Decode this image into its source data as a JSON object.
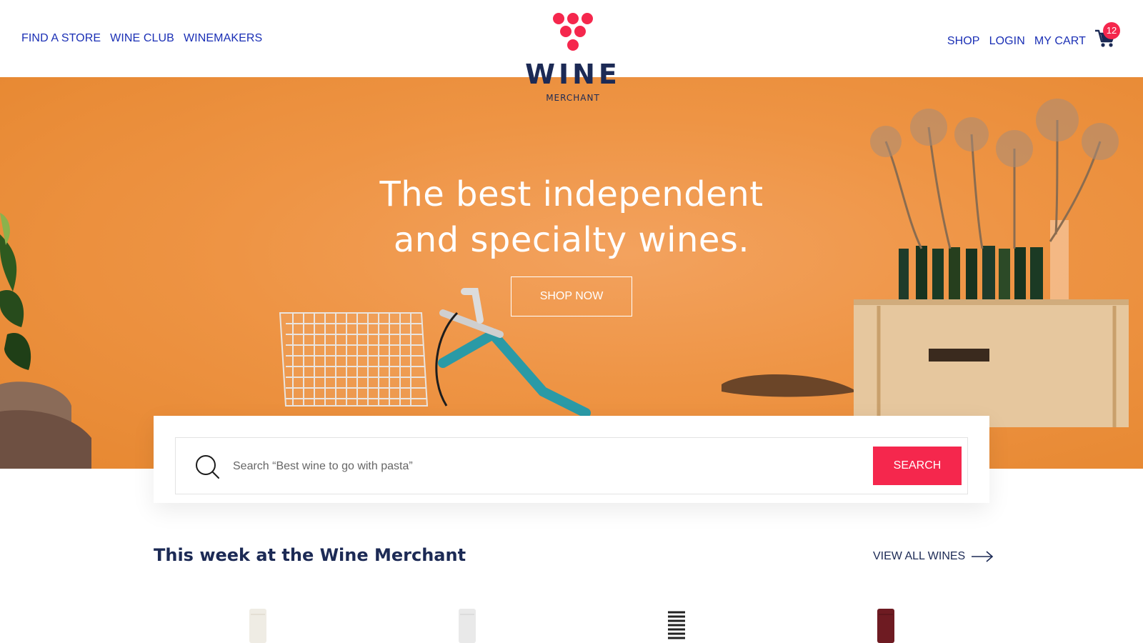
{
  "header": {
    "nav_left": [
      "FIND A STORE",
      "WINE CLUB",
      "WINEMAKERS"
    ],
    "nav_right": [
      "SHOP",
      "LOGIN",
      "MY CART"
    ],
    "cart_count": "12",
    "logo": {
      "word": "WINE",
      "sub": "MERCHANT"
    }
  },
  "hero": {
    "headline_line1": "The best independent",
    "headline_line2": "and specialty wines.",
    "cta": "SHOP NOW"
  },
  "search": {
    "placeholder": "Search “Best wine to go with pasta”",
    "button": "SEARCH"
  },
  "section": {
    "title": "This week at the Wine Merchant",
    "view_all": "VIEW ALL WINES"
  },
  "colors": {
    "accent": "#f5274d",
    "navy": "#1c2a55",
    "link": "#1a2fb5",
    "hero": "#ee9444"
  },
  "icons": [
    "search-icon",
    "cart-icon",
    "arrow-right-icon",
    "logo-dots-icon"
  ]
}
